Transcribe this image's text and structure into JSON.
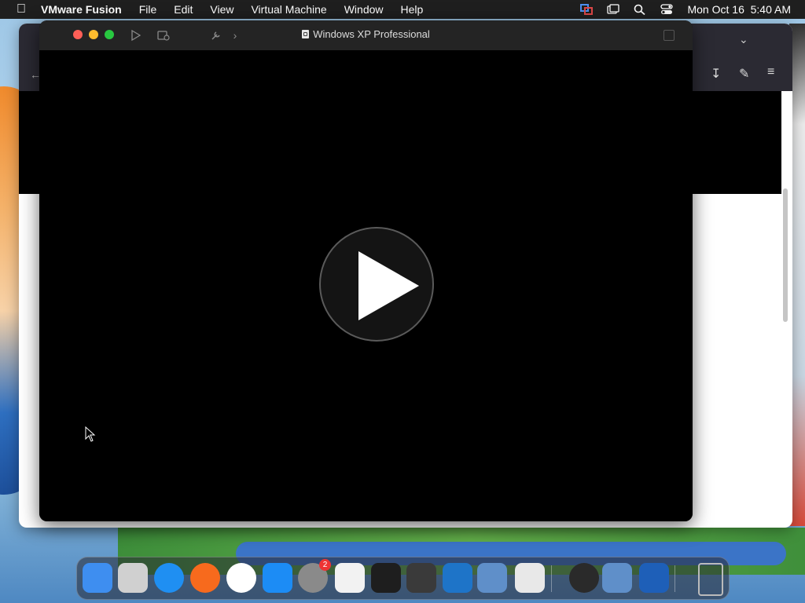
{
  "menubar": {
    "app_name": "VMware Fusion",
    "menus": [
      "File",
      "Edit",
      "View",
      "Virtual Machine",
      "Window",
      "Help"
    ],
    "clock": "Mon Oct 16  5:40 AM"
  },
  "vm_window": {
    "title": "Windows XP Professional",
    "play_button_label": "Play"
  },
  "dock": {
    "apps": [
      {
        "name": "finder",
        "color": "#3e8ef0"
      },
      {
        "name": "launchpad",
        "color": "#d0d0d0"
      },
      {
        "name": "safari",
        "color": "#1f8ff2"
      },
      {
        "name": "firefox",
        "color": "#f76a1d"
      },
      {
        "name": "chrome",
        "color": "#ffffff"
      },
      {
        "name": "app-store",
        "color": "#1c8cf5"
      },
      {
        "name": "system-settings",
        "color": "#8a8a8a",
        "badge": "2"
      },
      {
        "name": "textedit",
        "color": "#f2f2f2"
      },
      {
        "name": "terminal",
        "color": "#1e1e1e"
      },
      {
        "name": "garageband",
        "color": "#3a3a3a"
      },
      {
        "name": "vscode",
        "color": "#1e74c8"
      },
      {
        "name": "virtualbox",
        "color": "#5f8fc9"
      },
      {
        "name": "roblox",
        "color": "#e8e8e8"
      },
      {
        "name": "quicktime",
        "color": "#2a2a2a"
      },
      {
        "name": "virtualbox-vm",
        "color": "#5f8fc9"
      },
      {
        "name": "vmware-fusion",
        "color": "#1e5fb8"
      },
      {
        "name": "trash",
        "color": "#9a9a9a"
      }
    ]
  }
}
